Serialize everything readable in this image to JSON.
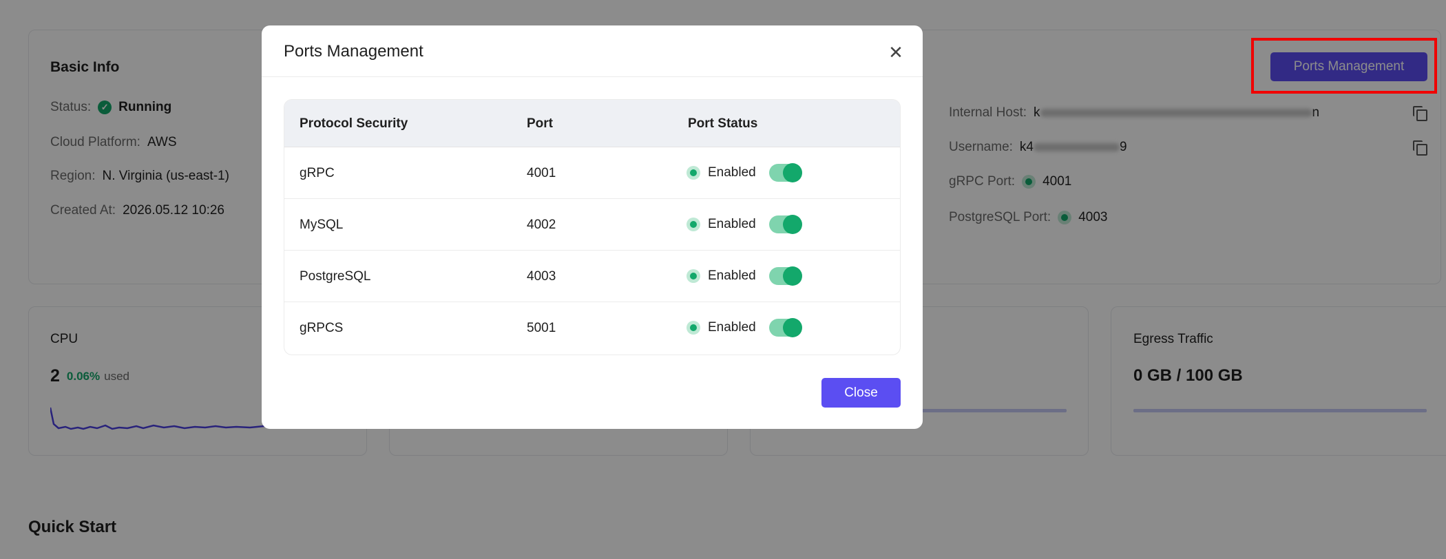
{
  "basic_info": {
    "title": "Basic Info",
    "status_label": "Status:",
    "status_value": "Running",
    "platform_label": "Cloud Platform:",
    "platform_value": "AWS",
    "region_label": "Region:",
    "region_value": "N. Virginia (us-east-1)",
    "created_label": "Created At:",
    "created_value": "2026.05.12 10:26"
  },
  "connection": {
    "internal_host_label": "Internal Host:",
    "internal_host_prefix": "k",
    "internal_host_suffix": "n",
    "username_label": "Username:",
    "username_prefix": "k4",
    "username_suffix": "9",
    "grpc_port_label": "gRPC Port:",
    "grpc_port_value": "4001",
    "pg_port_label": "PostgreSQL Port:",
    "pg_port_value": "4003",
    "ports_management_button": "Ports Management"
  },
  "metrics": {
    "cpu_title": "CPU",
    "cpu_value": "2",
    "cpu_used_pct": "0.06%",
    "cpu_used_label": "used",
    "egress_title": "Egress Traffic",
    "egress_value": "0 GB / 100 GB"
  },
  "quick_start": {
    "title": "Quick Start"
  },
  "modal": {
    "title": "Ports Management",
    "close_icon": "close-icon",
    "headers": [
      "Protocol Security",
      "Port",
      "Port Status"
    ],
    "rows": [
      {
        "protocol": "gRPC",
        "port": "4001",
        "status": "Enabled",
        "enabled": true
      },
      {
        "protocol": "MySQL",
        "port": "4002",
        "status": "Enabled",
        "enabled": true
      },
      {
        "protocol": "PostgreSQL",
        "port": "4003",
        "status": "Enabled",
        "enabled": true
      },
      {
        "protocol": "gRPCS",
        "port": "5001",
        "status": "Enabled",
        "enabled": true
      }
    ],
    "close_button": "Close"
  },
  "colors": {
    "accent": "#5b4ef2",
    "success": "#13a86b",
    "highlight": "#f00000"
  }
}
